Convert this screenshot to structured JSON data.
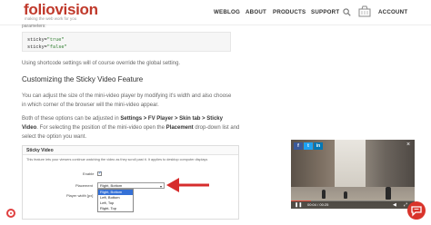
{
  "header": {
    "logo": "foliovision",
    "tagline": "making the web work for you",
    "nav": [
      "WEBLOG",
      "ABOUT",
      "PRODUCTS",
      "SUPPORT",
      "ACCOUNT"
    ]
  },
  "content": {
    "param_line": "parameters:",
    "code_lines": [
      {
        "key": "sticky=",
        "val": "\"true\""
      },
      {
        "key": "sticky=",
        "val": "\"false\""
      }
    ],
    "p1": "Using shortcode settings will of course override the global setting.",
    "heading": "Customizing the Sticky Video Feature",
    "p2": "You can adjust the size of the mini-video player by modifying it's width and also choose in which corner of the browser will the mini-video appear.",
    "p3_a": "Both of these options can be adjusted in ",
    "p3_b": "Settings > FV Player > Skin tab > Sticky Video",
    "p3_c": ". For selecting the position of the mini-video open the ",
    "p3_d": "Placement",
    "p3_e": " drop-down list and select the option you want."
  },
  "settings_panel": {
    "title": "Sticky Video",
    "description": "This feature lets your viewers continue watching the video as they scroll past it. It applies to desktop computer displays",
    "enable_label": "Enable",
    "placement_label": "Placement",
    "width_label": "Player width [px]",
    "placement_value": "Right, Bottom",
    "options": [
      "Right, Bottom",
      "Left, Bottom",
      "Left, Top",
      "Right, Top"
    ],
    "selected_index": 0
  },
  "player": {
    "share": [
      "f",
      "t",
      "in"
    ],
    "time": "00:04 / 00:25",
    "progress": 0.16,
    "colors": {
      "facebook": "#3b5998",
      "twitter": "#1da1f2",
      "linkedin": "#0077b5"
    }
  },
  "icons": {
    "search": "search-icon",
    "cart": "cart-icon",
    "chat": "chat-icon",
    "help": "help-icon"
  },
  "colors": {
    "brand": "#c0392b",
    "accent": "#d9342b"
  }
}
